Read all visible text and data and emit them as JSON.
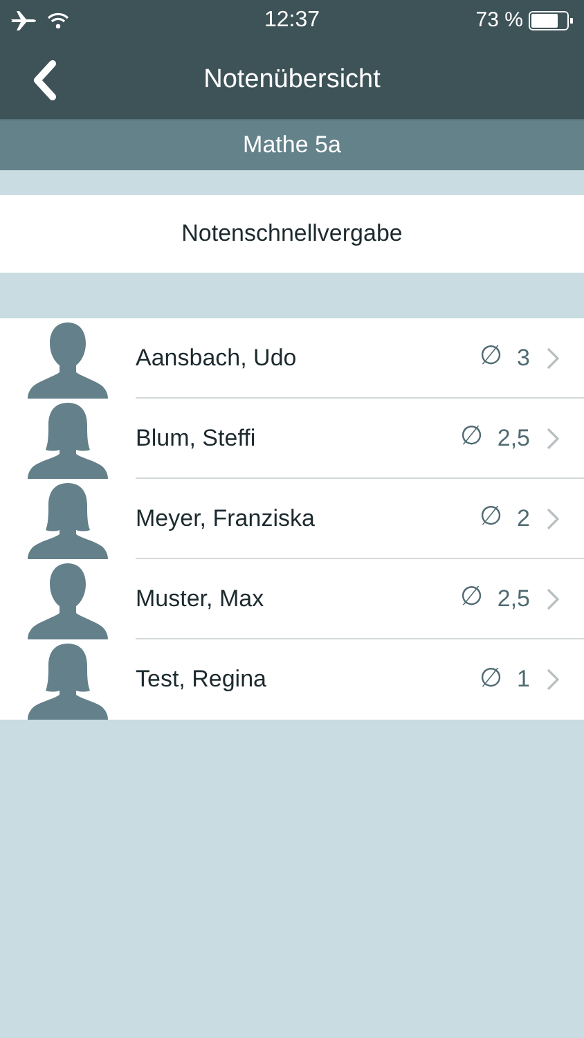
{
  "status_bar": {
    "time": "12:37",
    "battery_text": "73 %"
  },
  "nav_bar": {
    "title": "Notenübersicht"
  },
  "class_header": {
    "title": "Mathe 5a"
  },
  "quick_grading_button": {
    "label": "Notenschnellvergabe"
  },
  "students": [
    {
      "name": "Aansbach, Udo",
      "avg_symbol": "∅",
      "average": "3",
      "kind": "male"
    },
    {
      "name": "Blum, Steffi",
      "avg_symbol": "∅",
      "average": "2,5",
      "kind": "female"
    },
    {
      "name": "Meyer, Franziska",
      "avg_symbol": "∅",
      "average": "2",
      "kind": "female"
    },
    {
      "name": "Muster, Max",
      "avg_symbol": "∅",
      "average": "2,5",
      "kind": "male"
    },
    {
      "name": "Test, Regina",
      "avg_symbol": "∅",
      "average": "1",
      "kind": "female"
    }
  ]
}
